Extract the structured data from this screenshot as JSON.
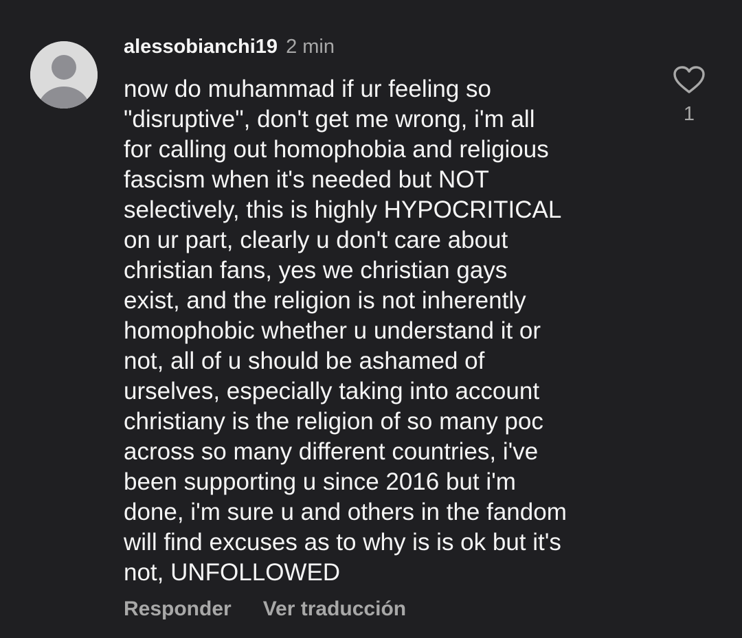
{
  "comment": {
    "username": "alessobianchi19",
    "time": "2 min",
    "text": "now do muhammad if ur feeling so\n\"disruptive\", don't get me wrong, i'm all\nfor calling out homophobia and religious\nfascism when it's needed but NOT\nselectively, this is highly HYPOCRITICAL\non ur part, clearly u don't care about\nchristian fans, yes we christian gays\nexist, and the religion is not inherently\nhomophobic whether u understand it or\nnot, all of u should be ashamed of\nurselves, especially taking into account\nchristiany is the religion of so many poc\nacross so many different countries, i've\nbeen supporting u since 2016 but i'm\ndone, i'm sure u and others in the fandom\nwill find excuses as to why is is ok but it's\nnot, UNFOLLOWED",
    "like_count": "1",
    "avatar_icon": "default-avatar-icon",
    "like_icon": "heart-outline-icon"
  },
  "actions": {
    "reply_label": "Responder",
    "translate_label": "Ver traducción"
  },
  "colors": {
    "background": "#1f1f22",
    "text_primary": "#f5f5f5",
    "text_secondary": "#a8a8a8",
    "avatar_bg": "#dbdbdb",
    "avatar_fg": "#8e8e93"
  }
}
